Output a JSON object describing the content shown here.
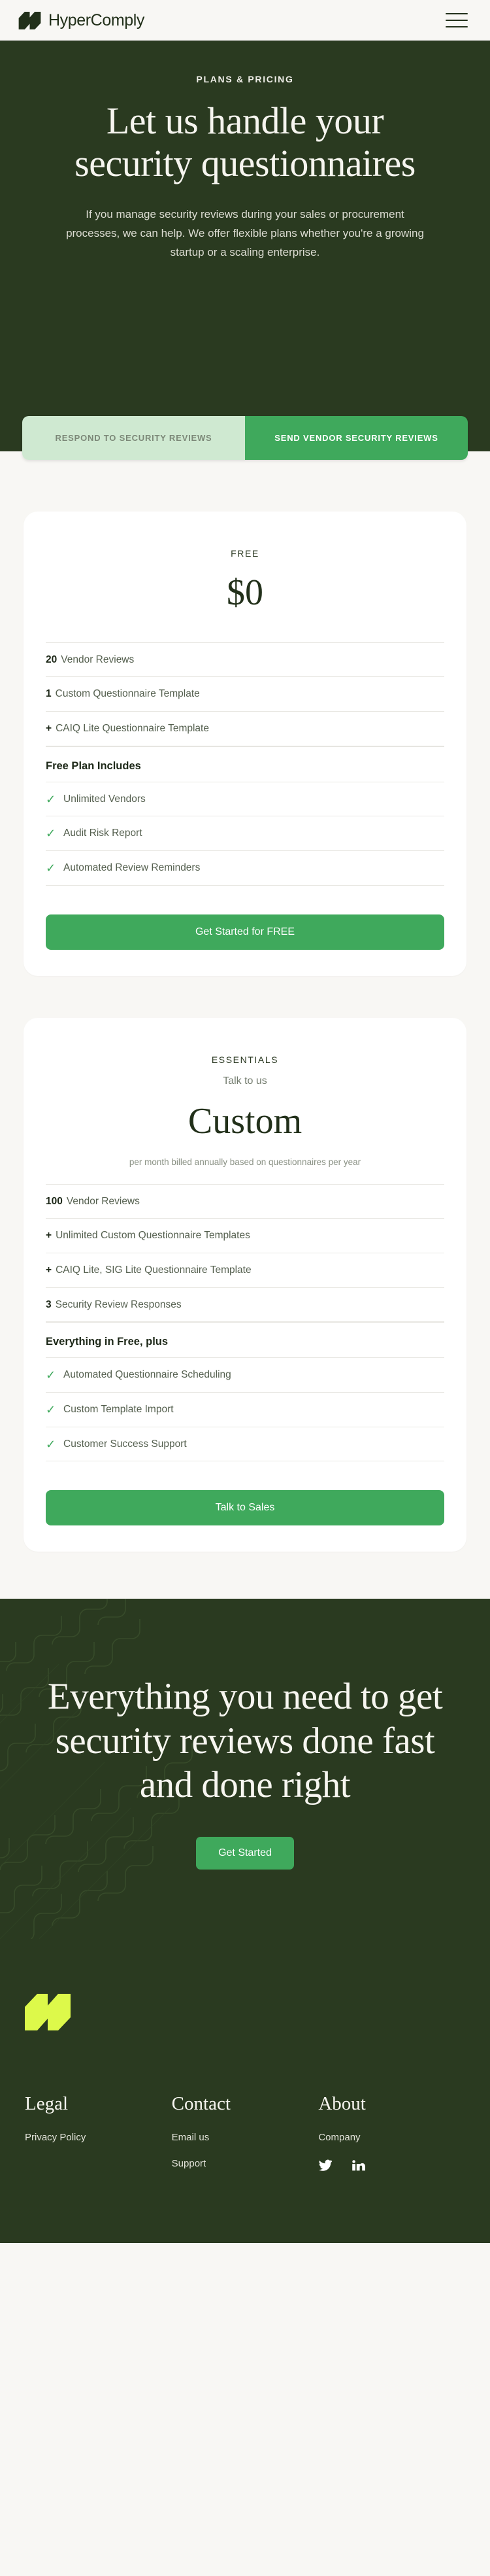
{
  "colors": {
    "dark_green": "#2A3A20",
    "accent_green": "#3FA95C",
    "tab_inactive": "#CFE9D1",
    "page_bg": "#F8F7F4",
    "logo_lime": "#DDF94A"
  },
  "nav": {
    "brand": "HyperComply",
    "menu_icon": "hamburger-icon"
  },
  "hero": {
    "eyebrow": "PLANS & PRICING",
    "title_line1": "Let us handle your",
    "title_line2": "security questionnaires",
    "description": "If you manage security reviews during your sales or procurement processes, we can help. We offer flexible plans whether you're a growing startup or a scaling enterprise."
  },
  "tabs": [
    {
      "label": "RESPOND TO SECURITY REVIEWS",
      "active": false
    },
    {
      "label": "SEND VENDOR SECURITY REVIEWS",
      "active": true
    }
  ],
  "plans": [
    {
      "name": "FREE",
      "sub": "",
      "price": "$0",
      "note": "",
      "specs": [
        {
          "lead": "20",
          "text": "Vendor Reviews"
        },
        {
          "lead": "1",
          "text": "Custom Questionnaire Template"
        },
        {
          "lead": "+",
          "text": "CAIQ Lite Questionnaire Template"
        }
      ],
      "group_title": "Free Plan Includes",
      "includes": [
        "Unlimited Vendors",
        "Audit Risk Report",
        "Automated Review Reminders"
      ],
      "cta": "Get Started for FREE"
    },
    {
      "name": "ESSENTIALS",
      "sub": "Talk to us",
      "price": "Custom",
      "note": "per month billed annually based on questionnaires per year",
      "specs": [
        {
          "lead": "100",
          "text": "Vendor Reviews"
        },
        {
          "lead": "+",
          "text": "Unlimited Custom Questionnaire Templates"
        },
        {
          "lead": "+",
          "text": "CAIQ Lite, SIG Lite Questionnaire Template"
        },
        {
          "lead": "3",
          "text": "Security Review Responses"
        }
      ],
      "group_title": "Everything in Free, plus",
      "includes": [
        "Automated Questionnaire Scheduling",
        "Custom Template Import",
        "Customer Success Support"
      ],
      "cta": "Talk to Sales"
    }
  ],
  "cta_band": {
    "heading": "Everything you need to get security reviews done fast and done right",
    "button": "Get Started"
  },
  "footer": {
    "columns": [
      {
        "heading": "Legal",
        "links": [
          "Privacy Policy"
        ]
      },
      {
        "heading": "Contact",
        "links": [
          "Email us",
          "Support"
        ]
      },
      {
        "heading": "About",
        "links": [
          "Company"
        ]
      }
    ],
    "socials": [
      "twitter-icon",
      "linkedin-icon"
    ]
  }
}
